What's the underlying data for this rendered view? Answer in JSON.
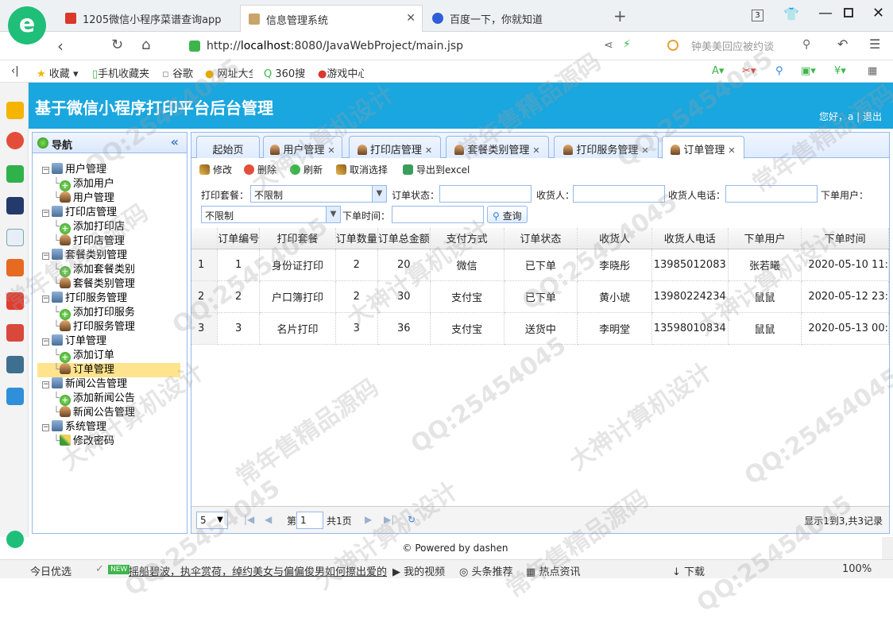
{
  "browser": {
    "tabs": [
      {
        "title": "1205微信小程序菜谱查询app",
        "active": false
      },
      {
        "title": "信息管理系统",
        "active": true
      },
      {
        "title": "百度一下，你就知道",
        "active": false
      }
    ],
    "new_tab": "+",
    "tab_count": "3",
    "url_scheme": "http://",
    "url_host": "localhost",
    "url_rest": ":8080/JavaWebProject/main.jsp",
    "search_hint": "钟美美回应被约谈",
    "zoom": "100%"
  },
  "bookmarks": [
    "收藏",
    "手机收藏夹",
    "谷歌",
    "网址大全",
    "360搜",
    "游戏中心"
  ],
  "app": {
    "title": "基于微信小程序打印平台后台管理",
    "user_text": "您好，a | 退出"
  },
  "nav": {
    "title": "导航",
    "collapse": "«",
    "groups": [
      {
        "label": "用户管理",
        "children": [
          "添加用户",
          "用户管理"
        ]
      },
      {
        "label": "打印店管理",
        "children": [
          "添加打印店",
          "打印店管理"
        ]
      },
      {
        "label": "套餐类别管理",
        "children": [
          "添加套餐类别",
          "套餐类别管理"
        ]
      },
      {
        "label": "打印服务管理",
        "children": [
          "添加打印服务",
          "打印服务管理"
        ]
      },
      {
        "label": "订单管理",
        "children": [
          "添加订单",
          "订单管理"
        ]
      },
      {
        "label": "新闻公告管理",
        "children": [
          "添加新闻公告",
          "新闻公告管理"
        ]
      },
      {
        "label": "系统管理",
        "children": [
          "修改密码"
        ]
      }
    ]
  },
  "tabs": [
    "起始页",
    "用户管理",
    "打印店管理",
    "套餐类别管理",
    "打印服务管理",
    "订单管理"
  ],
  "toolbar": {
    "edit": "修改",
    "delete": "删除",
    "refresh": "刷新",
    "cancel": "取消选择",
    "export": "导出到excel"
  },
  "filters": {
    "package_label": "打印套餐：",
    "package_value": "不限制",
    "status_label": "订单状态：",
    "status_value": "",
    "receiver_label": "收货人：",
    "receiver_value": "",
    "phone_label": "收货人电话：",
    "phone_value": "",
    "user_label": "下单用户：",
    "user_value": "不限制",
    "time_label": "下单时间：",
    "time_value": "",
    "query": "查询"
  },
  "grid": {
    "columns": [
      "订单编号",
      "打印套餐",
      "订单数量",
      "订单总金额",
      "支付方式",
      "订单状态",
      "收货人",
      "收货人电话",
      "下单用户",
      "下单时间"
    ],
    "rows": [
      [
        "1",
        "1",
        "身份证打印",
        "2",
        "20",
        "微信",
        "已下单",
        "李晓彤",
        "13985012083",
        "张若曦",
        "2020-05-10 11:"
      ],
      [
        "2",
        "2",
        "户口簿打印",
        "2",
        "30",
        "支付宝",
        "已下单",
        "黄小琥",
        "13980224234",
        "鼠鼠",
        "2020-05-12 23:"
      ],
      [
        "3",
        "3",
        "名片打印",
        "3",
        "36",
        "支付宝",
        "送货中",
        "李明堂",
        "13598010834",
        "鼠鼠",
        "2020-05-13 00:"
      ]
    ]
  },
  "pager": {
    "page_size": "5",
    "page_prefix": "第",
    "page": "1",
    "page_suffix": "共1页",
    "summary": "显示1到3,共3记录"
  },
  "footer": "© Powered by dashen",
  "status": [
    "今日优选",
    "摇船碧波，执伞赏荷，绰约美女与偏偏俊男如何擦出爱的",
    "我的视频",
    "头条推荐",
    "热点资讯",
    "下载",
    "100%"
  ],
  "watermarks": [
    "QQ:25454045",
    "大神计算机设计",
    "常年售精品源码"
  ]
}
